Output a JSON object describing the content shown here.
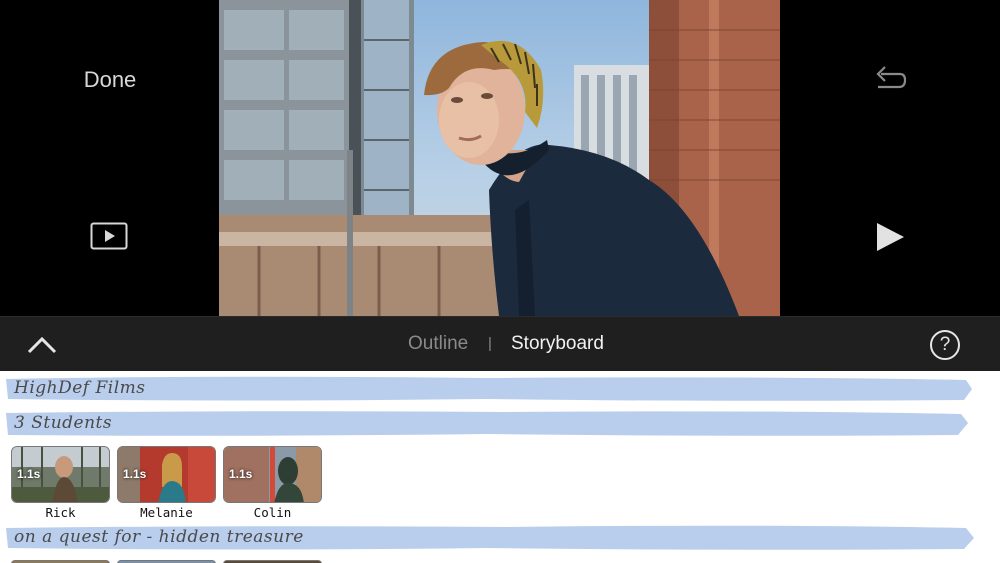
{
  "viewer": {
    "done_label": "Done",
    "icons": [
      "preview-icon",
      "undo-icon",
      "play-icon"
    ]
  },
  "toolbar": {
    "tabs": [
      {
        "label": "Outline",
        "selected": false
      },
      {
        "label": "Storyboard",
        "selected": true
      }
    ],
    "separator": "|",
    "help_label": "?"
  },
  "storyboard": {
    "sections": [
      {
        "text": "HighDef Films"
      },
      {
        "text": "3 Students"
      },
      {
        "text": "on a quest for - hidden treasure"
      }
    ],
    "clips": [
      {
        "name": "Rick",
        "duration": "1.1s"
      },
      {
        "name": "Melanie",
        "duration": "1.1s"
      },
      {
        "name": "Colin",
        "duration": "1.1s"
      }
    ]
  },
  "colors": {
    "toolbar_bg": "#1f1f1f",
    "band_blue": "#b9cdec",
    "selected_tab": "#f2f2f2",
    "unselected_tab": "#8a8a8a"
  }
}
